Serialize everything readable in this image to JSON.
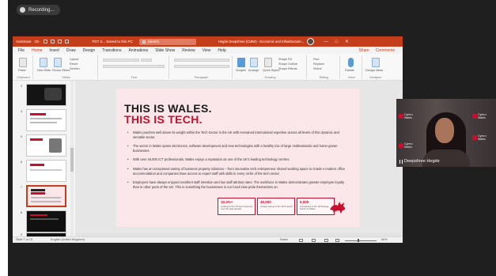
{
  "recording": {
    "label": "Recording..."
  },
  "window": {
    "autosave_label": "AutoSave",
    "autosave_state": "On",
    "document_title": "PDT 5... Saved to this PC",
    "search_placeholder": "Search",
    "user_name": "Hegde Deepshree (CIBW) - Economic and Infrastructure...",
    "minimize": "—",
    "maximize": "□",
    "close": "✕"
  },
  "ribbon_tabs": {
    "items": [
      "File",
      "Home",
      "Insert",
      "Draw",
      "Design",
      "Transitions",
      "Animations",
      "Slide Show",
      "Review",
      "View",
      "Help"
    ],
    "active": "Home",
    "share": "Share",
    "comments": "Comments"
  },
  "ribbon": {
    "clipboard": {
      "label": "Clipboard",
      "paste": "Paste"
    },
    "slides": {
      "label": "Slides",
      "new_slide": "New Slide",
      "reuse": "Reuse Slides",
      "layout": "Layout",
      "reset": "Reset",
      "section": "Section"
    },
    "font": {
      "label": "Font"
    },
    "paragraph": {
      "label": "Paragraph"
    },
    "drawing": {
      "label": "Drawing",
      "shapes": "Shapes",
      "arrange": "Arrange",
      "quick_styles": "Quick Styles",
      "fill": "Shape Fill",
      "outline": "Shape Outline",
      "effects": "Shape Effects"
    },
    "editing": {
      "label": "Editing",
      "find": "Find",
      "replace": "Replace",
      "select": "Select"
    },
    "voice": {
      "label": "Voice",
      "dictate": "Dictate"
    },
    "designer": {
      "label": "Designer",
      "design_ideas": "Design Ideas"
    }
  },
  "thumbnails": {
    "numbers": [
      "3",
      "4",
      "5",
      "6",
      "7",
      "8",
      "9"
    ],
    "selected": "7"
  },
  "slide": {
    "title_line1": "THIS IS WALES.",
    "title_line2": "THIS IS TECH.",
    "bullets": [
      "Wales punches well above its weight within the Tech Sector in the UK with renowned international expertise across all levels of this dynamic and versatile sector.",
      "The sector in Wales spans electronics, software development and new technologies with a healthy mix of large multinationals and home-grown businesses.",
      "With over 45,000 ICT professionals, Wales enjoys a reputation as one of the UK's leading technology centres.",
      "Wales has an exceptional variety of business property solutions – from innovative tech entrepreneur shared working space to Grade A modern office accommodation and companies have access to expert staff with skills in every niche of the tech sector.",
      "Employers have always enjoyed excellent staff retention and low staff attrition rates. The workforce in Wales demonstrates greater employee loyalty than in other parts of the UK. This is something the businesses in our fossil view pride themselves on."
    ],
    "stats": [
      {
        "number": "10.3%+",
        "caption": "Leading in the UK tech economy over the past decade"
      },
      {
        "number": "45,000",
        "caption": "Unique variety of the Tech Sector"
      },
      {
        "number": "5,000",
        "caption": "Companies in the Technology Sector in Wales"
      }
    ]
  },
  "status_bar": {
    "slide_info": "Slide 7 of 15",
    "language": "English (United Kingdom)",
    "notes": "Notes",
    "zoom": "66%"
  },
  "participant": {
    "name": "Deepshree Hegde",
    "logo_text": "Cymru\nWales"
  },
  "colors": {
    "powerpoint_accent": "#c43e1c",
    "slide_accent": "#c8102e",
    "meeting_background": "#1f1f1f"
  }
}
